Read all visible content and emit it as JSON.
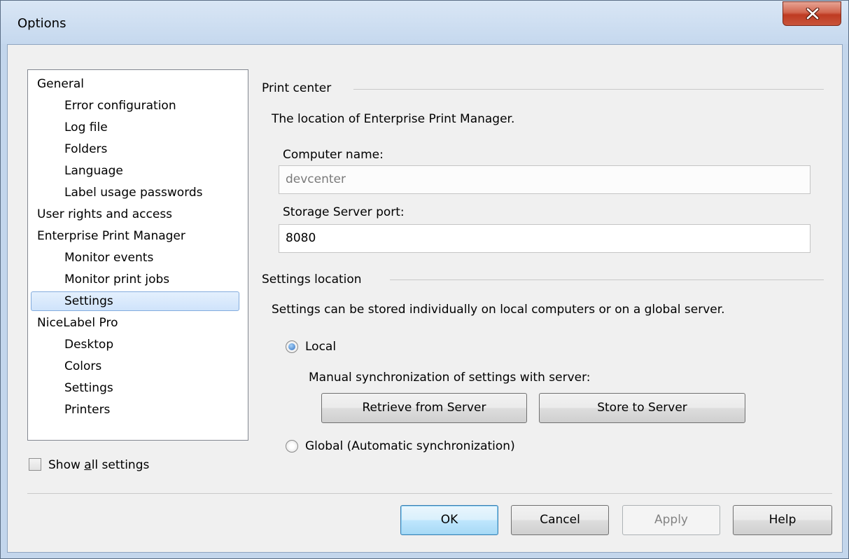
{
  "window": {
    "title": "Options"
  },
  "tree": {
    "items": [
      {
        "label": "General",
        "level": 0
      },
      {
        "label": "Error configuration",
        "level": 1
      },
      {
        "label": "Log file",
        "level": 1
      },
      {
        "label": "Folders",
        "level": 1
      },
      {
        "label": "Language",
        "level": 1
      },
      {
        "label": "Label usage passwords",
        "level": 1
      },
      {
        "label": "User rights and access",
        "level": 0
      },
      {
        "label": "Enterprise Print Manager",
        "level": 0
      },
      {
        "label": "Monitor events",
        "level": 1
      },
      {
        "label": "Monitor print jobs",
        "level": 1
      },
      {
        "label": "Settings",
        "level": 1,
        "selected": true
      },
      {
        "label": "NiceLabel Pro",
        "level": 0
      },
      {
        "label": "Desktop",
        "level": 1
      },
      {
        "label": "Colors",
        "level": 1
      },
      {
        "label": "Settings",
        "level": 1
      },
      {
        "label": "Printers",
        "level": 1
      }
    ]
  },
  "show_all": {
    "label_pre": "Show ",
    "label_accel": "a",
    "label_post": "ll settings",
    "checked": false
  },
  "print_center": {
    "heading": "Print center",
    "description": "The location of Enterprise Print Manager.",
    "computer_name_label": "Computer name:",
    "computer_name_value": "devcenter",
    "port_label": "Storage Server port:",
    "port_value": "8080"
  },
  "settings_location": {
    "heading": "Settings location",
    "description": "Settings can be stored individually on local computers or on a global server.",
    "local_label": "Local",
    "local_selected": true,
    "manual_sync_label": "Manual synchronization of settings with server:",
    "retrieve_button": "Retrieve from Server",
    "store_button": "Store to Server",
    "global_label": "Global (Automatic synchronization)",
    "global_selected": false
  },
  "footer": {
    "ok": "OK",
    "cancel": "Cancel",
    "apply": "Apply",
    "help": "Help"
  },
  "colors": {
    "selection_border": "#84acdd",
    "close_button": "#c7472e",
    "title_bar": "#c5d8ee"
  }
}
